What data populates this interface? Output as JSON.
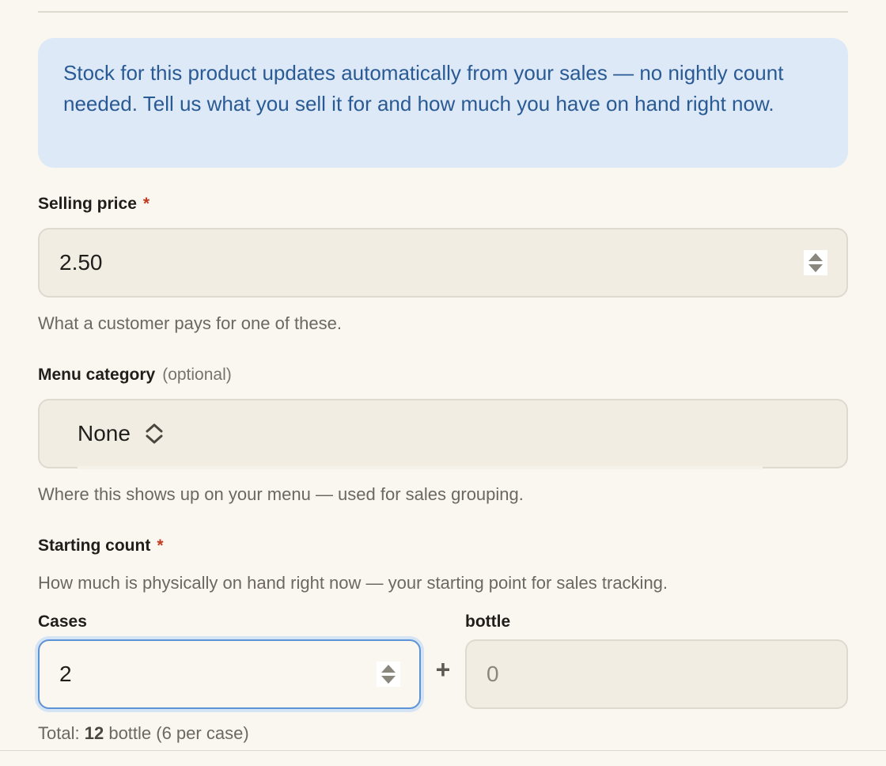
{
  "info_notice": "Stock for this product updates automatically from your sales — no nightly count needed. Tell us what you sell it for and how much you have on hand right now.",
  "selling_price": {
    "label": "Selling price",
    "required_marker": "*",
    "value": "2.50",
    "help": "What a customer pays for one of these."
  },
  "menu_category": {
    "label": "Menu category",
    "optional_tag": "(optional)",
    "selected": "None",
    "help": "Where this shows up on your menu — used for sales grouping."
  },
  "starting_count": {
    "label": "Starting count",
    "required_marker": "*",
    "help": "How much is physically on hand right now — your starting point for sales tracking.",
    "cases_label": "Cases",
    "cases_value": "2",
    "plus": "+",
    "units_label": "bottle",
    "units_placeholder": "0",
    "total_prefix": "Total:",
    "total_value": "12",
    "total_suffix": "bottle (6 per case)"
  },
  "colors": {
    "page_bg": "#faf7f0",
    "info_bg": "#dde9f7",
    "info_text": "#2a5a94",
    "required": "#c23a1f",
    "focus_border": "#5d93d6",
    "field_bg": "#f1ede3"
  },
  "icons": {
    "number_stepper": "spinner-arrows-icon",
    "select_chevron": "chevron-up-down-icon"
  }
}
